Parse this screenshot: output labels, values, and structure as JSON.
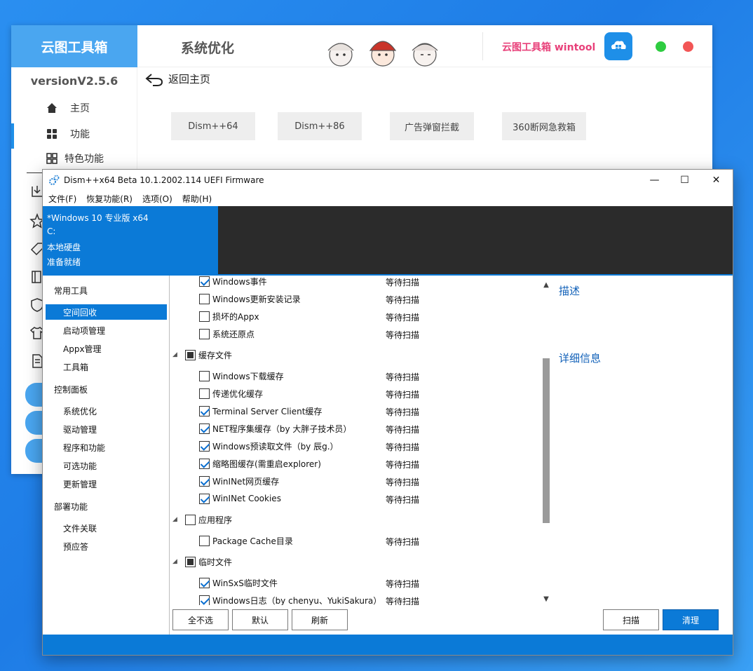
{
  "back_app": {
    "logo": "云图工具箱",
    "section_title": "系统优化",
    "brand": "云图工具箱 wintool",
    "version": "versionV2.5.6",
    "sidebar": [
      {
        "label": "主页",
        "icon": "home-icon"
      },
      {
        "label": "功能",
        "icon": "grid-icon"
      },
      {
        "label": "特色功能",
        "icon": "apps-icon"
      }
    ],
    "return_label": "返回主页",
    "tools": [
      "Dism++64",
      "Dism++86",
      "广告弹窗拦截",
      "360断网急救箱"
    ]
  },
  "dism": {
    "title": "Dism++x64 Beta 10.1.2002.114 UEFI Firmware",
    "menu": [
      "文件(F)",
      "恢复功能(R)",
      "选项(O)",
      "帮助(H)"
    ],
    "info": {
      "os": "*Windows 10 专业版 x64",
      "drive": "C:",
      "disk": "本地硬盘",
      "state": "准备就绪"
    },
    "nav": {
      "groups": [
        {
          "head": "常用工具",
          "items": [
            "空间回收",
            "启动项管理",
            "Appx管理",
            "工具箱"
          ]
        },
        {
          "head": "控制面板",
          "items": [
            "系统优化",
            "驱动管理",
            "程序和功能",
            "可选功能",
            "更新管理"
          ]
        },
        {
          "head": "部署功能",
          "items": [
            "文件关联",
            "预应答"
          ]
        }
      ],
      "selected": "空间回收"
    },
    "rows": [
      {
        "type": "item",
        "label": "Windows事件",
        "checked": true,
        "status": "等待扫描"
      },
      {
        "type": "item",
        "label": "Windows更新安装记录",
        "checked": false,
        "status": "等待扫描"
      },
      {
        "type": "item",
        "label": "损坏的Appx",
        "checked": false,
        "status": "等待扫描"
      },
      {
        "type": "item",
        "label": "系统还原点",
        "checked": false,
        "status": "等待扫描"
      },
      {
        "type": "group",
        "label": "缓存文件",
        "state": "partial"
      },
      {
        "type": "item",
        "label": "Windows下载缓存",
        "checked": false,
        "status": "等待扫描"
      },
      {
        "type": "item",
        "label": "传递优化缓存",
        "checked": false,
        "status": "等待扫描"
      },
      {
        "type": "item",
        "label": "Terminal Server Client缓存",
        "checked": true,
        "status": "等待扫描"
      },
      {
        "type": "item",
        "label": "NET程序集缓存（by 大胖子技术员）",
        "checked": true,
        "status": "等待扫描"
      },
      {
        "type": "item",
        "label": "Windows预读取文件（by 辰g.）",
        "checked": true,
        "status": "等待扫描"
      },
      {
        "type": "item",
        "label": "缩略图缓存(需重启explorer)",
        "checked": true,
        "status": "等待扫描"
      },
      {
        "type": "item",
        "label": "WinINet网页缓存",
        "checked": true,
        "status": "等待扫描"
      },
      {
        "type": "item",
        "label": "WinINet Cookies",
        "checked": true,
        "status": "等待扫描"
      },
      {
        "type": "group",
        "label": "应用程序",
        "state": "unchecked"
      },
      {
        "type": "item",
        "label": "Package Cache目录",
        "checked": false,
        "status": "等待扫描"
      },
      {
        "type": "group",
        "label": "临时文件",
        "state": "partial"
      },
      {
        "type": "item",
        "label": "WinSxS临时文件",
        "checked": true,
        "status": "等待扫描"
      },
      {
        "type": "item",
        "label": "Windows日志（by chenyu、YukiSakura）",
        "checked": true,
        "status": "等待扫描"
      }
    ],
    "desc_label": "描述",
    "detail_label": "详细信息",
    "buttons": {
      "select_none": "全不选",
      "default": "默认",
      "refresh": "刷新",
      "scan": "扫描",
      "clean": "清理"
    },
    "colors": {
      "accent": "#0b7ad7",
      "dark_panel": "#2b2b2b"
    }
  }
}
